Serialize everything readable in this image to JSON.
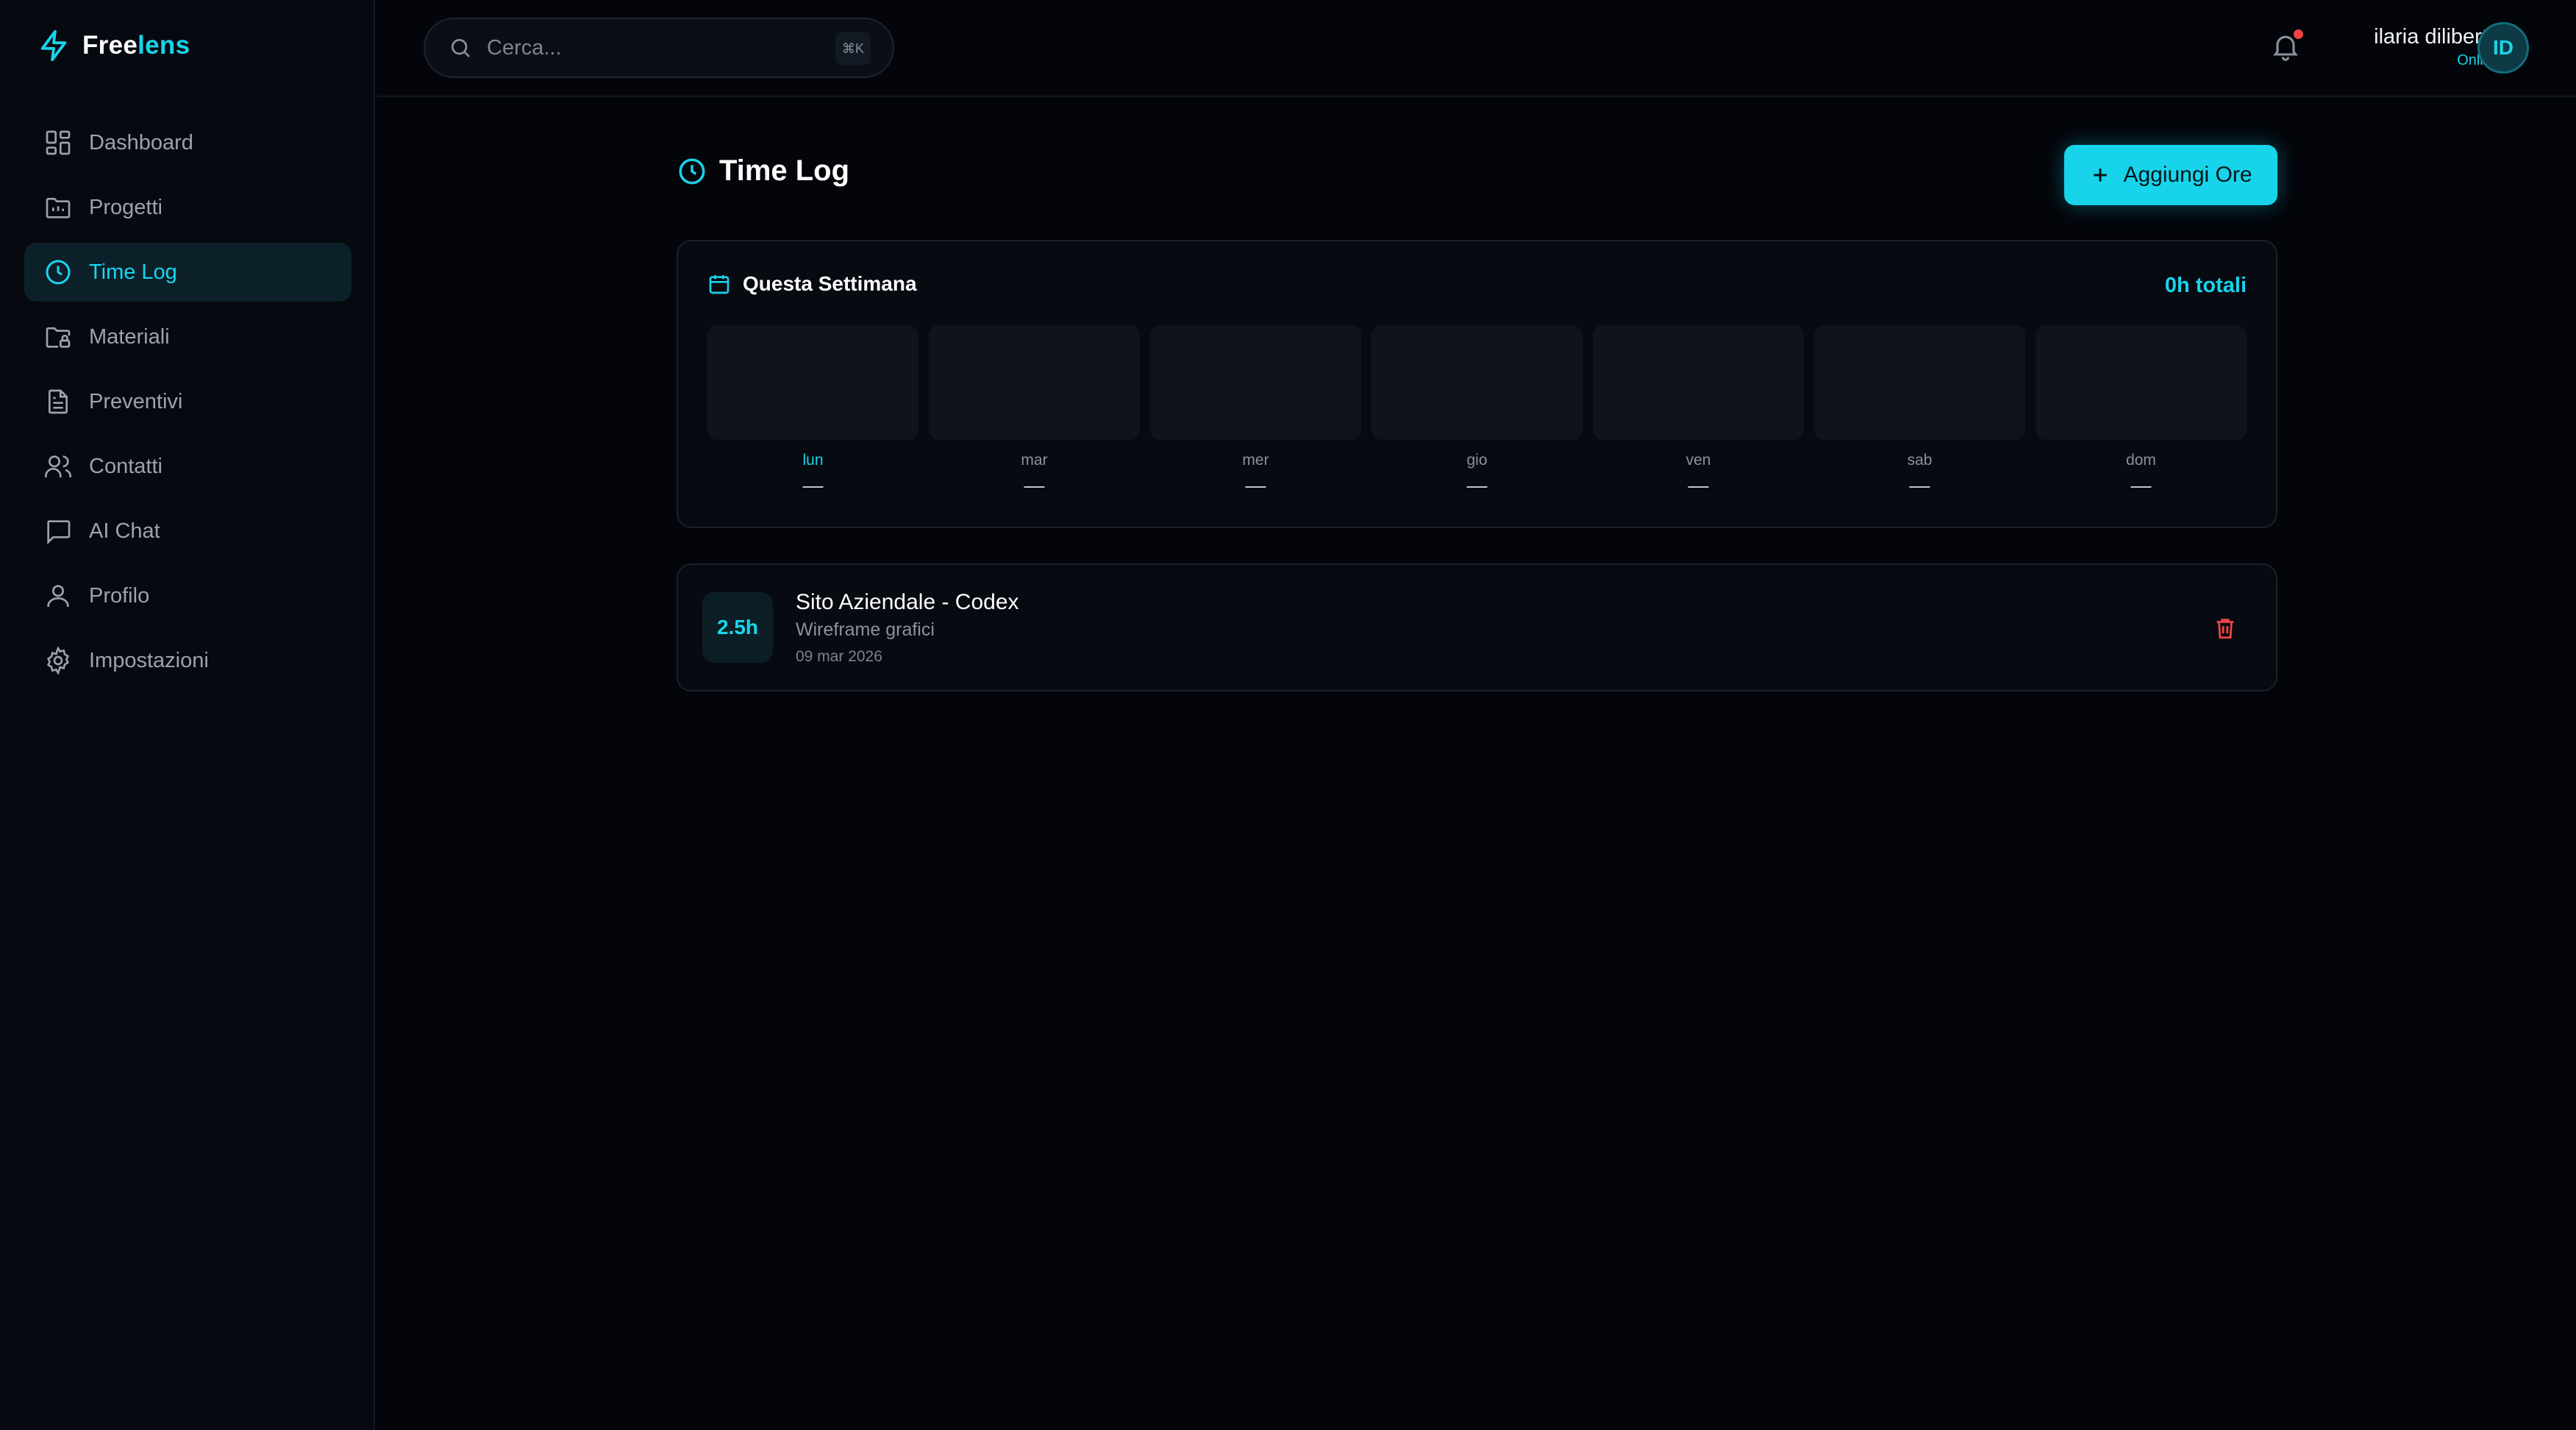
{
  "app": {
    "logo_part1": "Free",
    "logo_part2": "lens",
    "accent": "#18d3ea"
  },
  "sidebar": {
    "items": [
      {
        "label": "Dashboard",
        "icon": "dashboard-icon"
      },
      {
        "label": "Progetti",
        "icon": "folder-icon"
      },
      {
        "label": "Time Log",
        "icon": "clock-icon",
        "active": true
      },
      {
        "label": "Materiali",
        "icon": "folder-lock-icon"
      },
      {
        "label": "Preventivi",
        "icon": "document-icon"
      },
      {
        "label": "Contatti",
        "icon": "users-icon"
      },
      {
        "label": "AI Chat",
        "icon": "chat-icon"
      },
      {
        "label": "Profilo",
        "icon": "user-icon"
      },
      {
        "label": "Impostazioni",
        "icon": "gear-icon"
      }
    ]
  },
  "topbar": {
    "search_placeholder": "Cerca...",
    "search_shortcut": "⌘K",
    "user_name": "ilaria diliberto",
    "user_status": "Online",
    "avatar_initials": "ID"
  },
  "main": {
    "title": "Time Log",
    "add_button": "Aggiungi Ore",
    "week": {
      "title": "Questa Settimana",
      "total": "0h totali",
      "days": [
        {
          "name": "lun",
          "value": "—",
          "today": true
        },
        {
          "name": "mar",
          "value": "—"
        },
        {
          "name": "mer",
          "value": "—"
        },
        {
          "name": "gio",
          "value": "—"
        },
        {
          "name": "ven",
          "value": "—"
        },
        {
          "name": "sab",
          "value": "—"
        },
        {
          "name": "dom",
          "value": "—"
        }
      ]
    },
    "entries": [
      {
        "hours": "2.5h",
        "title": "Sito Aziendale - Codex",
        "description": "Wireframe grafici",
        "date": "09 mar 2026"
      }
    ]
  }
}
